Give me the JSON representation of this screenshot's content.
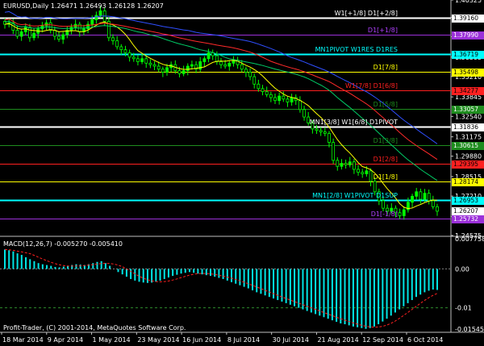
{
  "window": {
    "symbol_title": "EURUSD,Daily",
    "ohlc": "1.26471 1.26493 1.26128 1.26207",
    "indicator_title": "MACD(12,26,7) -0.005270 -0.005410",
    "copyright": "Profit-Trader, (C) 2001-2014, MetaQuotes Software Corp."
  },
  "colors": {
    "background": "#000000",
    "candle": "#00ff00",
    "ma_fast": "#ffff00",
    "ma_mid": "#00cc66",
    "ma_slow_red": "#ff2a2a",
    "ma_slow_blue": "#2f4fff",
    "macd_hist": "#00e5e5",
    "macd_signal": "#ff2020",
    "grid": "#808080"
  },
  "price_scale": [
    "1.40325",
    "1.39160",
    "1.37870",
    "1.36505",
    "1.35210",
    "1.33845",
    "1.32540",
    "1.31175",
    "1.29880",
    "1.28515",
    "1.27210",
    "1.25845",
    "1.24575"
  ],
  "macd_scale": [
    "0.007758",
    "0.00",
    "-0.01",
    "-0.015454"
  ],
  "dates": [
    "18 Mar 2014",
    "9 Apr 2014",
    "1 May 2014",
    "23 May 2014",
    "16 Jun 2014",
    "8 Jul 2014",
    "30 Jul 2014",
    "21 Aug 2014",
    "12 Sep 2014",
    "6 Oct 2014"
  ],
  "murrey_levels": [
    {
      "label": "W1[+1/8] D1[+2/8]",
      "price_tag": "1.39160",
      "line_color": "#ffffff",
      "tag_bg": "#ffffff",
      "tag_fg": "#000000",
      "label_color": "#ffffff"
    },
    {
      "label": "D1[+1/8]",
      "price_tag": "1.37990",
      "line_color": "#9b30d9",
      "tag_bg": "#9b30d9",
      "tag_fg": "#ffffff",
      "label_color": "#b040ff"
    },
    {
      "label": "MN1PIVOT W1RES D1RES",
      "price_tag": "1.36719",
      "line_color": "#00ffff",
      "tag_bg": "#00ffff",
      "tag_fg": "#000000",
      "label_color": "#00ffff"
    },
    {
      "label": "D1[7/8]",
      "price_tag": "1.35498",
      "line_color": "#ffff00",
      "tag_bg": "#ffff00",
      "tag_fg": "#000000",
      "label_color": "#ffff00"
    },
    {
      "label": "W1[7/8] D1[6/8]",
      "price_tag": "1.34277",
      "line_color": "#ff2020",
      "tag_bg": "#ff2020",
      "tag_fg": "#000000",
      "label_color": "#ff2020"
    },
    {
      "label": "D1[5/8]",
      "price_tag": "1.33057",
      "line_color": "#1e8c1e",
      "tag_bg": "#1e8c1e",
      "tag_fg": "#ffffff",
      "label_color": "#1e8c1e"
    },
    {
      "label": "MN1[3/8] W1[6/8] D1PIVOT",
      "price_tag": "1.31836",
      "line_color": "#ffffff",
      "tag_bg": "#ffffff",
      "tag_fg": "#000000",
      "label_color": "#ffffff"
    },
    {
      "label": "D1[3/8]",
      "price_tag": "1.30615",
      "line_color": "#1e8c1e",
      "tag_bg": "#1e8c1e",
      "tag_fg": "#ffffff",
      "label_color": "#1e8c1e"
    },
    {
      "label": "D1[2/8]",
      "price_tag": "1.29395",
      "line_color": "#ff2020",
      "tag_bg": "#ff2020",
      "tag_fg": "#000000",
      "label_color": "#ff2020"
    },
    {
      "label": "D1[1/8]",
      "price_tag": "1.28174",
      "line_color": "#ffff00",
      "tag_bg": "#ffff00",
      "tag_fg": "#000000",
      "label_color": "#ffff00"
    },
    {
      "label": "MN1[2/8] W1PIVOT D1SUP",
      "price_tag": "1.26953",
      "line_color": "#00ffff",
      "tag_bg": "#00ffff",
      "tag_fg": "#000000",
      "label_color": "#00ffff"
    },
    {
      "label": "D1[-1/8]",
      "price_tag": "1.25732",
      "line_color": "#9b30d9",
      "tag_bg": "#9b30d9",
      "tag_fg": "#ffffff",
      "label_color": "#b040ff"
    }
  ],
  "current_price_tag": "1.26207",
  "chart_data": {
    "type": "candlestick",
    "closes": [
      1.387,
      1.388,
      1.383,
      1.379,
      1.382,
      1.385,
      1.378,
      1.381,
      1.384,
      1.386,
      1.388,
      1.383,
      1.379,
      1.377,
      1.38,
      1.383,
      1.385,
      1.387,
      1.382,
      1.384,
      1.387,
      1.39,
      1.393,
      1.396,
      1.389,
      1.378,
      1.376,
      1.372,
      1.37,
      1.368,
      1.365,
      1.364,
      1.362,
      1.364,
      1.361,
      1.36,
      1.359,
      1.357,
      1.355,
      1.358,
      1.36,
      1.356,
      1.354,
      1.356,
      1.359,
      1.36,
      1.357,
      1.362,
      1.364,
      1.368,
      1.366,
      1.362,
      1.36,
      1.359,
      1.361,
      1.363,
      1.36,
      1.357,
      1.355,
      1.352,
      1.347,
      1.344,
      1.342,
      1.34,
      1.338,
      1.336,
      1.339,
      1.337,
      1.335,
      1.338,
      1.336,
      1.33,
      1.325,
      1.321,
      1.317,
      1.316,
      1.315,
      1.314,
      1.308,
      1.296,
      1.292,
      1.294,
      1.293,
      1.295,
      1.29,
      1.288,
      1.287,
      1.289,
      1.282,
      1.275,
      1.269,
      1.264,
      1.262,
      1.264,
      1.261,
      1.259,
      1.263,
      1.268,
      1.272,
      1.275,
      1.27,
      1.274,
      1.269,
      1.265,
      1.262
    ],
    "macd_hist": [
      0.005,
      0.0048,
      0.0045,
      0.004,
      0.0036,
      0.003,
      0.0025,
      0.002,
      0.0015,
      0.0012,
      0.001,
      0.0008,
      0.0005,
      0.0004,
      0.0006,
      0.0008,
      0.001,
      0.0012,
      0.0011,
      0.001,
      0.0012,
      0.0015,
      0.0018,
      0.002,
      0.0015,
      0.0008,
      0.0,
      -0.0008,
      -0.0014,
      -0.002,
      -0.0026,
      -0.003,
      -0.0033,
      -0.0035,
      -0.0036,
      -0.0035,
      -0.0033,
      -0.003,
      -0.0026,
      -0.0022,
      -0.0018,
      -0.0015,
      -0.0012,
      -0.001,
      -0.0008,
      -0.001,
      -0.0012,
      -0.0014,
      -0.0016,
      -0.0018,
      -0.002,
      -0.0023,
      -0.0026,
      -0.003,
      -0.0034,
      -0.0038,
      -0.0042,
      -0.0046,
      -0.005,
      -0.0055,
      -0.006,
      -0.0064,
      -0.0068,
      -0.0072,
      -0.0076,
      -0.008,
      -0.0084,
      -0.0088,
      -0.0092,
      -0.0096,
      -0.01,
      -0.0104,
      -0.0108,
      -0.0112,
      -0.0116,
      -0.012,
      -0.0124,
      -0.0128,
      -0.0132,
      -0.0136,
      -0.014,
      -0.0142,
      -0.0145,
      -0.0148,
      -0.015,
      -0.0152,
      -0.0154,
      -0.0152,
      -0.0148,
      -0.0142,
      -0.0135,
      -0.0128,
      -0.012,
      -0.0112,
      -0.0104,
      -0.0096,
      -0.0088,
      -0.008,
      -0.0072,
      -0.0066,
      -0.006,
      -0.0056,
      -0.0053,
      -0.0054
    ]
  }
}
